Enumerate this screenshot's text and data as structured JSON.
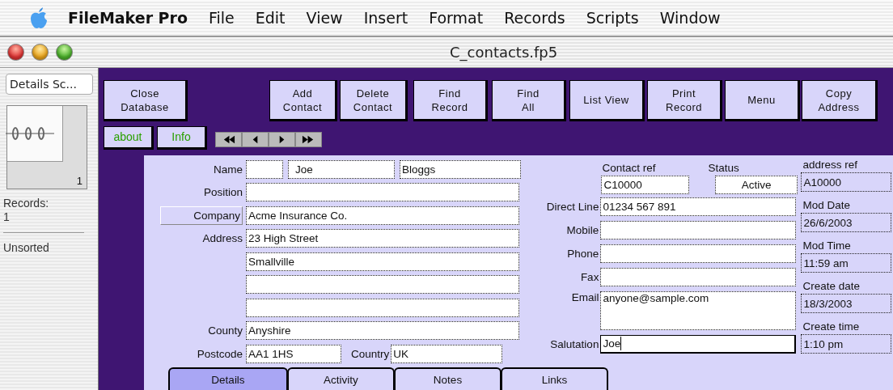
{
  "menu_bar": {
    "app_name": "FileMaker Pro",
    "items": [
      "File",
      "Edit",
      "View",
      "Insert",
      "Format",
      "Records",
      "Scripts",
      "Window"
    ]
  },
  "window": {
    "title": "C_contacts.fp5"
  },
  "sidebar": {
    "layout_menu": "Details Sc...",
    "record_number": "1",
    "records_label": "Records:",
    "records_count": "1",
    "sort_status": "Unsorted"
  },
  "toolbar": {
    "buttons": [
      {
        "lines": [
          "Close",
          "Database"
        ]
      },
      {
        "lines": [
          "Add",
          "Contact"
        ]
      },
      {
        "lines": [
          "Delete",
          "Contact"
        ]
      },
      {
        "lines": [
          "Find",
          "Record"
        ]
      },
      {
        "lines": [
          "Find",
          "All"
        ]
      },
      {
        "lines": [
          "List View"
        ]
      },
      {
        "lines": [
          "Print",
          "Record"
        ]
      },
      {
        "lines": [
          "Menu"
        ]
      },
      {
        "lines": [
          "Copy",
          "Address"
        ]
      }
    ],
    "small_buttons": [
      "about",
      "Info"
    ]
  },
  "form": {
    "name_row": {
      "label": "Name",
      "first_name": "Joe",
      "last_name": "Bloggs"
    },
    "left_rows": [
      {
        "kind": "label",
        "label": "Position"
      },
      {
        "kind": "button",
        "label": "Company",
        "value": "Acme Insurance Co."
      },
      {
        "kind": "label",
        "label": "Address",
        "value": "23 High Street"
      },
      {
        "kind": "plain",
        "value": "Smallville"
      },
      {
        "kind": "plain"
      },
      {
        "kind": "plain"
      },
      {
        "kind": "label",
        "label": "County",
        "value": "Anyshire"
      }
    ],
    "postcode_row": {
      "label": "Postcode",
      "value": "AA1 1HS",
      "country_label": "Country",
      "country": "UK"
    },
    "contact_ref": {
      "label": "Contact ref",
      "value": "C10000"
    },
    "status": {
      "label": "Status",
      "value": "Active"
    },
    "middle_rows": [
      {
        "kind": "line",
        "label": "Direct Line",
        "value": "01234 567 891"
      },
      {
        "kind": "line",
        "label": "Mobile"
      },
      {
        "kind": "line",
        "label": "Phone"
      },
      {
        "kind": "line",
        "label": "Fax"
      },
      {
        "kind": "tall",
        "label": "Email",
        "value": "anyone@sample.com"
      },
      {
        "kind": "active",
        "label": "Salutation",
        "value": "Joe"
      }
    ],
    "right_fields": [
      {
        "label": "address ref",
        "value": "A10000"
      },
      {
        "label": "Mod Date",
        "value": "26/6/2003"
      },
      {
        "label": "Mod Time",
        "value": "11:59 am"
      },
      {
        "label": "Create date",
        "value": "18/3/2003"
      },
      {
        "label": "Create time",
        "value": "1:10 pm"
      }
    ]
  },
  "tabs": [
    {
      "label": "Details",
      "selected": true
    },
    {
      "label": "Activity",
      "selected": false
    },
    {
      "label": "Notes",
      "selected": false
    },
    {
      "label": "Links",
      "selected": false
    }
  ]
}
